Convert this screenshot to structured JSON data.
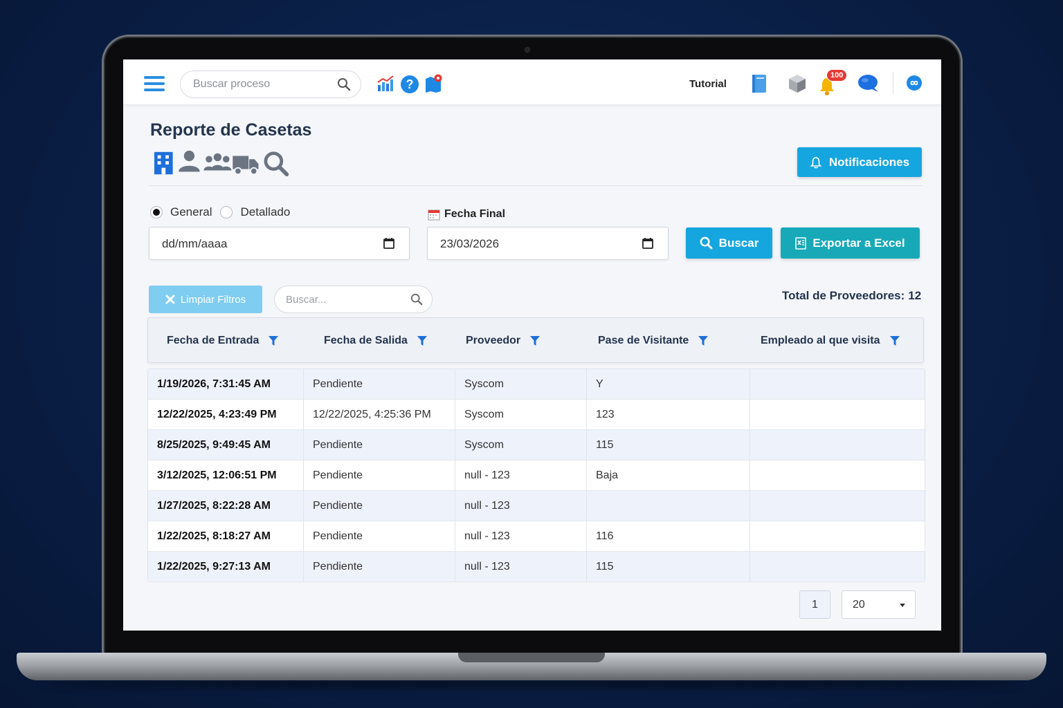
{
  "topbar": {
    "search_placeholder": "Buscar proceso",
    "tutorial_label": "Tutorial",
    "notifications_badge": "100"
  },
  "page": {
    "title": "Reporte de Casetas",
    "notificaciones_label": "Notificaciones"
  },
  "filters": {
    "radio_general": "General",
    "radio_detallado": "Detallado",
    "selected_mode": "General",
    "fecha_final_label": "Fecha Final",
    "fecha_inicio_value": "dd/mm/aaaa",
    "fecha_final_value": "23/03/2026",
    "buscar_label": "Buscar",
    "exportar_label": "Exportar a Excel",
    "limpiar_label": "Limpiar Filtros",
    "table_search_placeholder": "Buscar...",
    "total_label": "Total de Proveedores:",
    "total_value": "12"
  },
  "table": {
    "columns": [
      "Fecha de Entrada",
      "Fecha de Salida",
      "Proveedor",
      "Pase de Visitante",
      "Empleado al que visita"
    ],
    "rows": [
      [
        "1/19/2026, 7:31:45 AM",
        "Pendiente",
        "Syscom",
        "Y",
        ""
      ],
      [
        "12/22/2025, 4:23:49 PM",
        "12/22/2025, 4:25:36 PM",
        "Syscom",
        "123",
        ""
      ],
      [
        "8/25/2025, 9:49:45 AM",
        "Pendiente",
        "Syscom",
        "115",
        ""
      ],
      [
        "3/12/2025, 12:06:51 PM",
        "Pendiente",
        "null - 123",
        "Baja",
        ""
      ],
      [
        "1/27/2025, 8:22:28 AM",
        "Pendiente",
        "null - 123",
        "",
        ""
      ],
      [
        "1/22/2025, 8:18:27 AM",
        "Pendiente",
        "null - 123",
        "116",
        ""
      ],
      [
        "1/22/2025, 9:27:13 AM",
        "Pendiente",
        "null - 123",
        "115",
        ""
      ]
    ]
  },
  "pager": {
    "current_page": "1",
    "page_size": "20"
  },
  "colors": {
    "primary": "#16a6df",
    "excel": "#17a9b8",
    "limpiar": "#7fcdf0",
    "title": "#24344d",
    "badge": "#e53935"
  }
}
